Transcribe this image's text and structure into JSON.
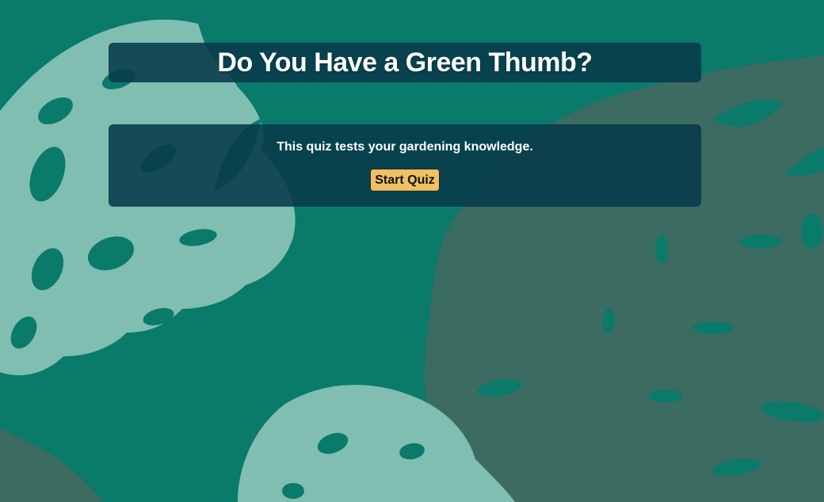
{
  "page": {
    "title": "Do You Have a Green Thumb?"
  },
  "intro": {
    "text": "This quiz tests your gardening knowledge.",
    "start_label": "Start Quiz"
  },
  "colors": {
    "background": "#0a7a6a",
    "panel": "#073a4a",
    "button": "#f0c064",
    "leaf_light": "#80beb2",
    "leaf_dark": "#3c6b62"
  },
  "icons": {
    "background_art": "monstera-leaf-icon"
  }
}
